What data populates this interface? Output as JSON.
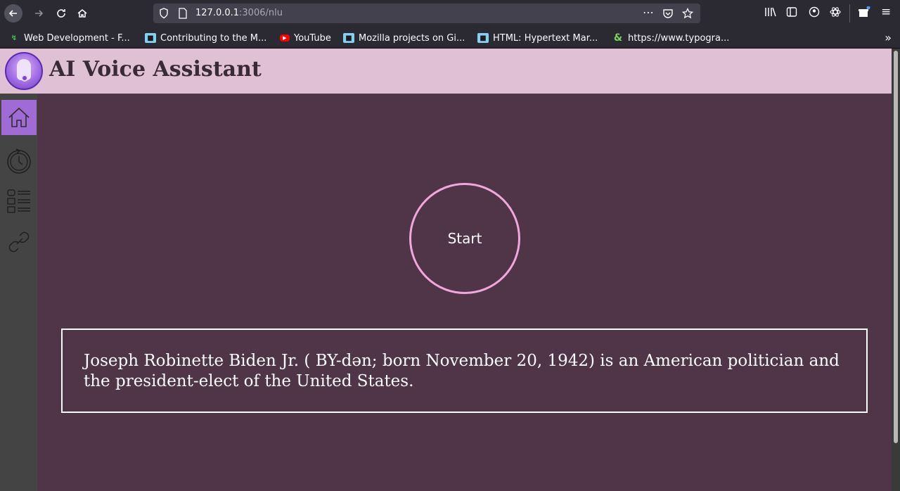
{
  "browser": {
    "url_host": "127.0.0.1",
    "url_path": ":3006/nlu",
    "bookmarks": [
      {
        "label": "Web Development - F...",
        "icon": "mdn-icon"
      },
      {
        "label": "Contributing to the M...",
        "icon": "mdn-icon"
      },
      {
        "label": "YouTube",
        "icon": "youtube-icon"
      },
      {
        "label": "Mozilla projects on Gi...",
        "icon": "mdn-icon"
      },
      {
        "label": "HTML: Hypertext Mar...",
        "icon": "mdn-icon"
      },
      {
        "label": "https://www.typogra...",
        "icon": "ampersand-icon"
      }
    ]
  },
  "app": {
    "title": "AI Voice Assistant",
    "start_label": "Start",
    "transcript": "Joseph Robinette Biden Jr. ( BY-dən; born November 20, 1942) is an American politician and the president-elect of the United States.",
    "sidebar": [
      {
        "name": "home-icon",
        "active": true
      },
      {
        "name": "history-icon",
        "active": false
      },
      {
        "name": "list-icon",
        "active": false
      },
      {
        "name": "link-icon",
        "active": false
      }
    ],
    "colors": {
      "header_bg": "#e0c0d5",
      "main_bg": "#503448",
      "sidebar_bg": "#444444",
      "active_item": "#a16bd6",
      "start_ring": "#f0a7dc"
    }
  }
}
